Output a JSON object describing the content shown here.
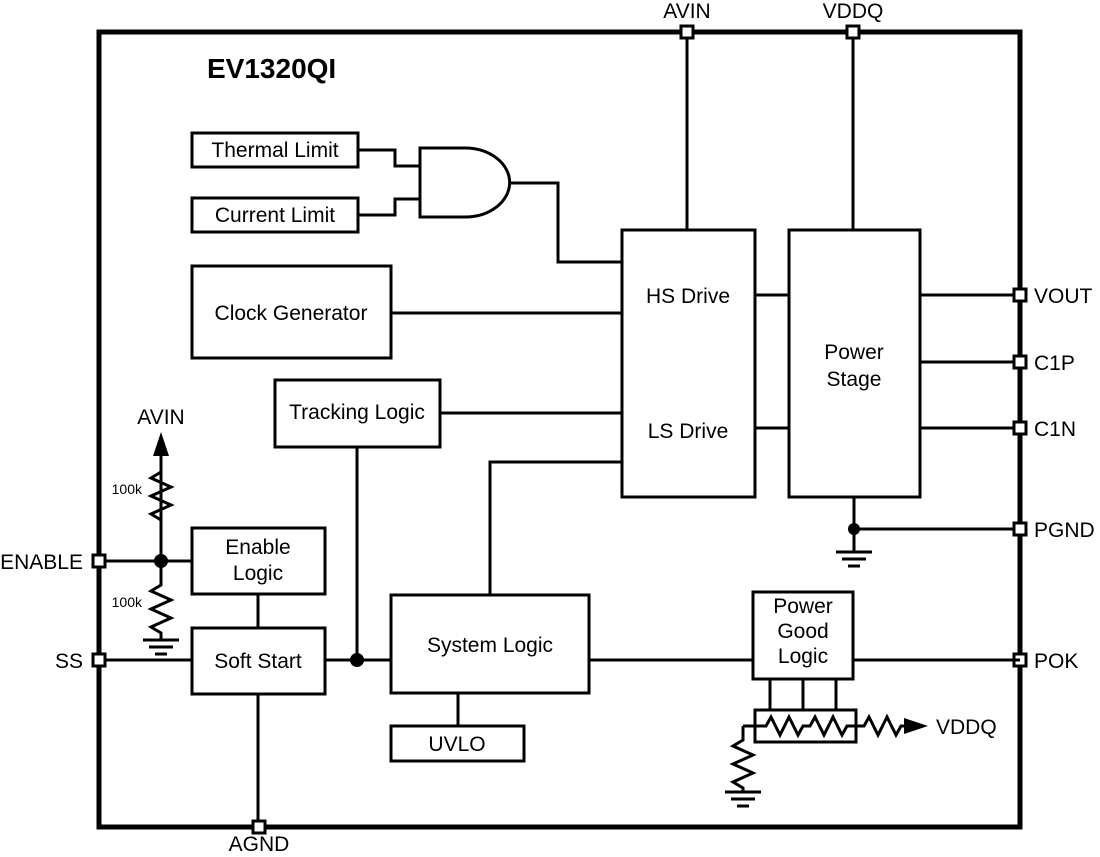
{
  "diagram": {
    "title": "EV1320QI",
    "blocks": {
      "thermal_limit": "Thermal Limit",
      "current_limit": "Current Limit",
      "clock_generator": "Clock Generator",
      "tracking_logic": "Tracking Logic",
      "hs_drive": "HS Drive",
      "ls_drive": "LS Drive",
      "power_stage_line1": "Power",
      "power_stage_line2": "Stage",
      "enable_logic_line1": "Enable",
      "enable_logic_line2": "Logic",
      "soft_start": "Soft Start",
      "system_logic": "System Logic",
      "uvlo": "UVLO",
      "power_good_line1": "Power",
      "power_good_line2": "Good",
      "power_good_line3": "Logic"
    },
    "pins": {
      "top": [
        {
          "name": "AVIN",
          "label": "AVIN"
        },
        {
          "name": "VDDQ",
          "label": "VDDQ"
        }
      ],
      "right": [
        {
          "name": "VOUT",
          "label": "VOUT"
        },
        {
          "name": "C1P",
          "label": "C1P"
        },
        {
          "name": "C1N",
          "label": "C1N"
        },
        {
          "name": "PGND",
          "label": "PGND"
        },
        {
          "name": "POK",
          "label": "POK"
        }
      ],
      "left": [
        {
          "name": "ENABLE",
          "label": "ENABLE"
        },
        {
          "name": "SS",
          "label": "SS"
        }
      ],
      "bottom": [
        {
          "name": "AGND",
          "label": "AGND"
        }
      ]
    },
    "internal_labels": {
      "avin_rail": "AVIN",
      "vddq_rail": "VDDQ",
      "resistor_top": "100k",
      "resistor_bottom": "100k"
    },
    "colors": {
      "line": "#000000",
      "background": "#ffffff"
    }
  }
}
